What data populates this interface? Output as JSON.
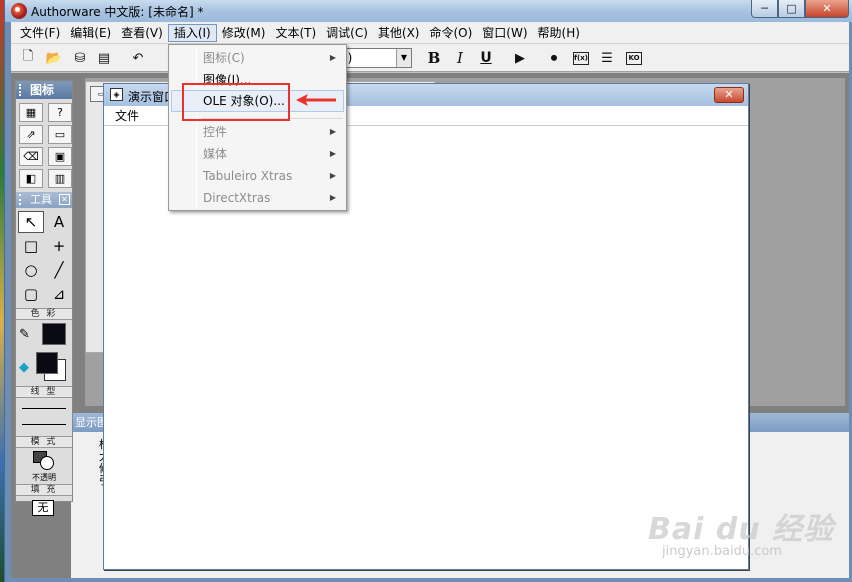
{
  "window": {
    "title": "Authorware 中文版: [未命名] *",
    "controls": {
      "minimize": "─",
      "maximize": "□",
      "close": "✕"
    }
  },
  "menubar": {
    "items": [
      "文件(F)",
      "编辑(E)",
      "查看(V)",
      "插入(I)",
      "修改(M)",
      "文本(T)",
      "调试(C)",
      "其他(X)",
      "命令(O)",
      "窗口(W)",
      "帮助(H)"
    ],
    "active_index": 3
  },
  "toolbar": {
    "font_field": "S)",
    "bold": "B",
    "italic": "I",
    "underline": "U",
    "fn_label": "f(x)",
    "ko_label": "KO"
  },
  "insert_menu": {
    "items": [
      {
        "label": "图标(C)",
        "enabled": false,
        "submenu": true
      },
      {
        "label": "图像(I)...",
        "enabled": true,
        "submenu": false
      },
      {
        "label": "OLE 对象(O)...",
        "enabled": true,
        "submenu": false,
        "highlighted": true
      },
      {
        "label": "控件",
        "enabled": false,
        "submenu": true
      },
      {
        "label": "媒体",
        "enabled": false,
        "submenu": true
      },
      {
        "label": "Tabuleiro Xtras",
        "enabled": false,
        "submenu": true
      },
      {
        "label": "DirectXtras",
        "enabled": false,
        "submenu": true
      }
    ]
  },
  "icon_palette": {
    "title": "图标"
  },
  "tools_palette": {
    "title": "工具",
    "color_label": "色 彩",
    "line_label": "线 型",
    "mode_label": "模 式",
    "mode_value": "不透明",
    "fill_label": "填 充",
    "fill_value": "无"
  },
  "presentation_window": {
    "title": "演示窗口",
    "menu": "文件"
  },
  "bottom_panel": {
    "title": "显示图",
    "text_lines": [
      "标",
      "大",
      "修",
      "引"
    ]
  },
  "watermark": {
    "brand": "Bai du 经验",
    "url": "jingyan.baidu.com"
  },
  "colors": {
    "highlight_border": "#e8322b",
    "menu_highlight": "#e8eff8"
  }
}
